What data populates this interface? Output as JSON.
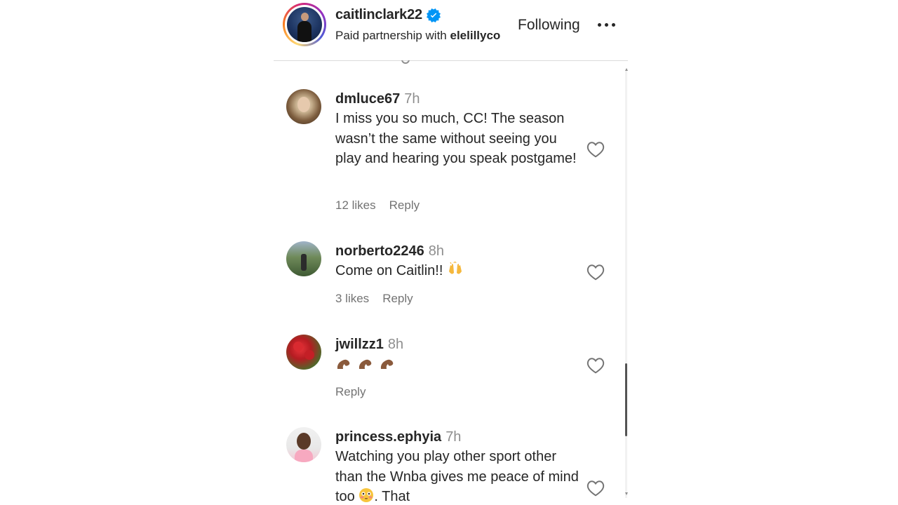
{
  "header": {
    "username": "caitlinclark22",
    "verified_icon": "verified-badge-icon",
    "partnership_prefix": "Paid partnership with",
    "partner": "elelillyco",
    "follow_label": "Following",
    "more_icon": "more-options-icon"
  },
  "comments": [
    {
      "username": "dmluce67",
      "time": "7h",
      "text": "I miss you so much, CC! The season wasn’t the same without seeing you play and hearing you speak postgame!",
      "likes": "12 likes",
      "reply": "Reply"
    },
    {
      "username": "norberto2246",
      "time": "8h",
      "text": "Come on Caitlin!!",
      "text_emoji": "raising-hands-emoji",
      "likes": "3 likes",
      "reply": "Reply"
    },
    {
      "username": "jwillzz1",
      "time": "8h",
      "text_emoji": "flexed-biceps-emoji x3",
      "reply": "Reply"
    },
    {
      "username": "princess.ephyia",
      "time": "7h",
      "text": "Watching you play other sport other than the Wnba gives me peace of mind too",
      "text_tail": ". That",
      "text_emoji": "flushed-face-emoji"
    }
  ],
  "colors": {
    "text": "#262626",
    "secondary": "#8e8e8e",
    "verified": "#0095f6",
    "divider": "#dbdbdb"
  }
}
